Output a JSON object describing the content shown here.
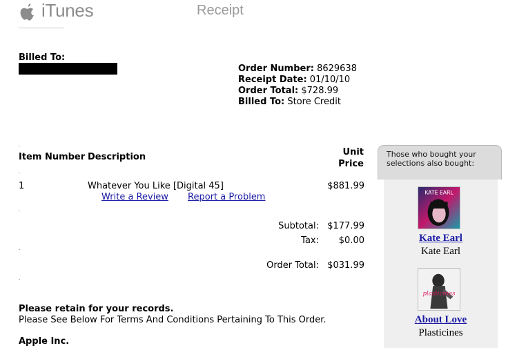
{
  "header": {
    "brand": "iTunes",
    "title": "Receipt"
  },
  "billed_to": {
    "label": "Billed To:"
  },
  "order": {
    "number_label": "Order Number:",
    "number": "8629638",
    "date_label": "Receipt Date:",
    "date": "01/10/10",
    "total_label": "Order Total:",
    "total": "$728.99",
    "billed_label": "Billed To:",
    "billed": "Store Credit"
  },
  "table": {
    "headers": {
      "item_number": "Item Number",
      "description": "Description",
      "unit": "Unit",
      "price": "Price"
    },
    "items": [
      {
        "number": "1",
        "description": "Whatever You Like [Digital 45]",
        "price": "$881.99",
        "write_review": "Write a Review",
        "report_problem": "Report a Problem"
      }
    ]
  },
  "totals": {
    "subtotal_label": "Subtotal:",
    "subtotal": "$177.99",
    "tax_label": "Tax:",
    "tax": "$0.00",
    "order_total_label": "Order Total:",
    "order_total": "$031.99"
  },
  "footer": {
    "retain": "Please retain for your records.",
    "terms": "Please See Below For Terms And Conditions Pertaining To This Order.",
    "company": "Apple Inc."
  },
  "sidebar": {
    "heading_line1": "Those who bought your",
    "heading_line2": "selections also bought:",
    "items": [
      {
        "title": "Kate Earl",
        "artist": "Kate Earl",
        "art_text": "KATE EARL"
      },
      {
        "title": "About Love",
        "artist": "Plasticines",
        "art_text": "plasticines"
      }
    ]
  },
  "colors": {
    "link": "#1a1aa6",
    "brand_gray": "#8c8c8c",
    "sidebar_header": "#dcdcdc",
    "sidebar_body": "#efefef"
  }
}
